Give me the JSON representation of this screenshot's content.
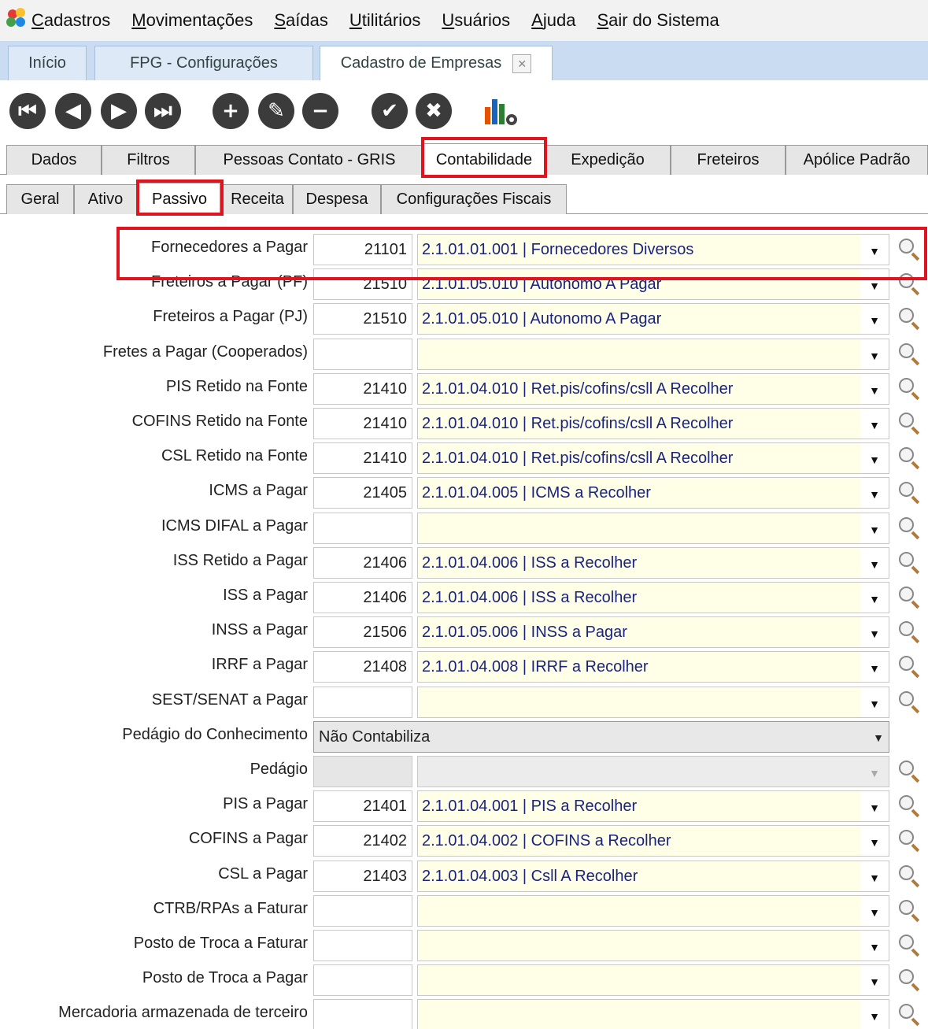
{
  "menu": [
    "Cadastros",
    "Movimentações",
    "Saídas",
    "Utilitários",
    "Usuários",
    "Ajuda",
    "Sair do Sistema"
  ],
  "window_tabs": [
    {
      "label": "Início"
    },
    {
      "label": "FPG - Configurações"
    },
    {
      "label": "Cadastro de Empresas",
      "closable": true
    }
  ],
  "toolbar": {
    "buttons": [
      {
        "name": "first-record-icon",
        "glyph": "⏮"
      },
      {
        "name": "previous-record-icon",
        "glyph": "◀"
      },
      {
        "name": "next-record-icon",
        "glyph": "▶"
      },
      {
        "name": "last-record-icon",
        "glyph": "⏭"
      },
      {
        "name": "add-record-icon",
        "glyph": "+"
      },
      {
        "name": "edit-record-icon",
        "glyph": "✎"
      },
      {
        "name": "remove-record-icon",
        "glyph": "−"
      },
      {
        "name": "confirm-icon",
        "glyph": "✔"
      },
      {
        "name": "cancel-icon",
        "glyph": "✖"
      }
    ],
    "chart_icon": "chart-settings-icon"
  },
  "main_tabs": [
    "Dados",
    "Filtros",
    "Pessoas Contato - GRIS",
    "Contabilidade",
    "Expedição",
    "Freteiros",
    "Apólice Padrão"
  ],
  "main_tab_active": "Contabilidade",
  "sub_tabs": [
    "Geral",
    "Ativo",
    "Passivo",
    "Receita",
    "Despesa",
    "Configurações Fiscais"
  ],
  "sub_tab_active": "Passivo",
  "rows": [
    {
      "label": "Fornecedores a Pagar",
      "code": "21101",
      "account": "2.1.01.01.001 | Fornecedores Diversos"
    },
    {
      "label": "Freteiros a Pagar (PF)",
      "code": "21510",
      "account": "2.1.01.05.010 | Autonomo A Pagar"
    },
    {
      "label": "Freteiros a Pagar (PJ)",
      "code": "21510",
      "account": "2.1.01.05.010 | Autonomo A Pagar"
    },
    {
      "label": "Fretes a Pagar (Cooperados)",
      "code": "",
      "account": ""
    },
    {
      "label": "PIS Retido na Fonte",
      "code": "21410",
      "account": "2.1.01.04.010 | Ret.pis/cofins/csll A Recolher"
    },
    {
      "label": "COFINS Retido na Fonte",
      "code": "21410",
      "account": "2.1.01.04.010 | Ret.pis/cofins/csll A Recolher"
    },
    {
      "label": "CSL Retido na Fonte",
      "code": "21410",
      "account": "2.1.01.04.010 | Ret.pis/cofins/csll A Recolher"
    },
    {
      "label": "ICMS a Pagar",
      "code": "21405",
      "account": "2.1.01.04.005 | ICMS a Recolher"
    },
    {
      "label": "ICMS DIFAL a Pagar",
      "code": "",
      "account": ""
    },
    {
      "label": "ISS Retido a Pagar",
      "code": "21406",
      "account": "2.1.01.04.006 | ISS a Recolher"
    },
    {
      "label": "ISS a Pagar",
      "code": "21406",
      "account": "2.1.01.04.006 | ISS a Recolher"
    },
    {
      "label": "INSS a Pagar",
      "code": "21506",
      "account": "2.1.01.05.006 | INSS a Pagar"
    },
    {
      "label": "IRRF a Pagar",
      "code": "21408",
      "account": "2.1.01.04.008 | IRRF a Recolher"
    },
    {
      "label": "SEST/SENAT a Pagar",
      "code": "",
      "account": ""
    },
    {
      "label": "Pedágio do Conhecimento",
      "select": "Não Contabiliza"
    },
    {
      "label": "Pedágio",
      "code": "",
      "account": "",
      "disabled": true
    },
    {
      "label": "PIS a Pagar",
      "code": "21401",
      "account": "2.1.01.04.001 | PIS a Recolher"
    },
    {
      "label": "COFINS a Pagar",
      "code": "21402",
      "account": "2.1.01.04.002 | COFINS a Recolher"
    },
    {
      "label": "CSL a Pagar",
      "code": "21403",
      "account": "2.1.01.04.003 | Csll A Recolher"
    },
    {
      "label": "CTRB/RPAs a Faturar",
      "code": "",
      "account": ""
    },
    {
      "label": "Posto de Troca a Faturar",
      "code": "",
      "account": ""
    },
    {
      "label": "Posto de Troca a Pagar",
      "code": "",
      "account": ""
    },
    {
      "label": "Mercadoria armazenada de terceiro",
      "code": "",
      "account": ""
    }
  ],
  "colors": {
    "highlight": "#e0141e",
    "account_text": "#1a237e",
    "field_bg": "#ffffe8",
    "tabbar_bg": "#c9dcf1"
  }
}
